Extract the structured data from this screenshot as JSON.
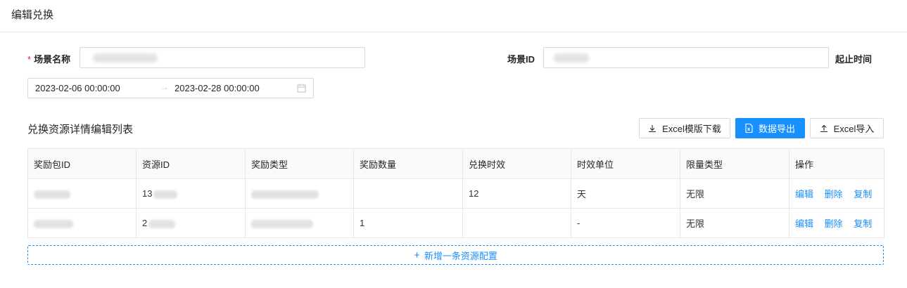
{
  "header": {
    "title": "编辑兑换"
  },
  "form": {
    "scene_name_label": "场景名称",
    "required_mark": "*",
    "scene_id_label": "场景ID",
    "time_label": "起止时间",
    "start_date": "2023-02-06 00:00:00",
    "end_date": "2023-02-28 00:00:00",
    "range_separator": "→"
  },
  "section": {
    "title": "兑换资源详情编辑列表"
  },
  "toolbar": {
    "excel_template_label": "Excel模版下载",
    "export_label": "数据导出",
    "excel_import_label": "Excel导入"
  },
  "table": {
    "columns": [
      "奖励包ID",
      "资源ID",
      "奖励类型",
      "奖励数量",
      "兑换时效",
      "时效单位",
      "限量类型",
      "操作"
    ],
    "rows": [
      {
        "resource_id_prefix": "13",
        "quantity": "",
        "validity": "12",
        "unit": "天",
        "limit_type": "无限"
      },
      {
        "resource_id_prefix": "2",
        "quantity": "1",
        "validity": "",
        "unit": "-",
        "limit_type": "无限"
      }
    ],
    "actions": {
      "edit": "编辑",
      "delete": "删除",
      "copy": "复制"
    }
  },
  "add_button": {
    "icon": "+",
    "label": "新增一条资源配置"
  },
  "colors": {
    "primary": "#1890ff",
    "required": "#f5222d",
    "border": "#d9d9d9"
  }
}
